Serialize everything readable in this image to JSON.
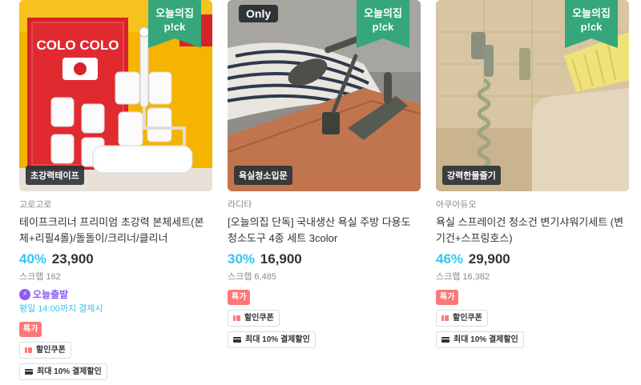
{
  "products": [
    {
      "pick_label": "오늘의집 p!ck",
      "image_badge": "초강력테이프",
      "brand": "고로고로",
      "title": "테이프크리너 프리미엄 초강력 본체세트(본체+리필4롤)/돌돌이/크리너/클리너",
      "discount": "40%",
      "price": "23,900",
      "scrap": "스크랩 162",
      "departure_label": "오늘출발",
      "departure_note": "평일 14:00까지 결제시",
      "special_badge": "특가",
      "chips": [
        "할인쿠폰",
        "최대 10% 결제할인"
      ],
      "image_text": {
        "brand_mark": "COLO COLO"
      }
    },
    {
      "only_label": "Only",
      "pick_label": "오늘의집 p!ck",
      "image_badge": "욕실청소입문",
      "brand": "라디타",
      "title": "[오늘의집 단독] 국내생산 욕실 주방 다용도 청소도구 4종 세트 3color",
      "discount": "30%",
      "price": "16,900",
      "scrap": "스크랩 6,485",
      "special_badge": "특가",
      "chips": [
        "할인쿠폰",
        "최대 10% 결제할인"
      ]
    },
    {
      "pick_label": "오늘의집 p!ck",
      "image_badge": "강력한물줄기",
      "brand": "아쿠아듀오",
      "title": "욕실 스프레이건 청소건 변기샤워기세트 (변기건+스프링호스)",
      "discount": "46%",
      "price": "29,900",
      "scrap": "스크랩 16,382",
      "special_badge": "특가",
      "chips": [
        "할인쿠폰",
        "최대 10% 결제할인"
      ]
    }
  ],
  "colors": {
    "accent_discount": "#35c5f0",
    "pick_green": "#35a77a",
    "special_red": "#ff7777",
    "departure_purple": "#8b5cf6"
  }
}
